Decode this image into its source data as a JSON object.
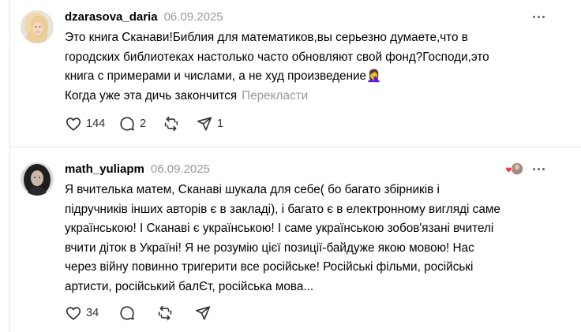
{
  "posts": [
    {
      "username": "dzarasova_daria",
      "date": "06.09.2025",
      "lines": [
        "Это книга Сканави!Библия для математиков,вы серьезно думаете,что в",
        "городских библиотеках настолько часто обновляют свой фонд?Господи,это",
        "книга с примерами и числами, а не худ произведение🤦‍♀️",
        "Когда уже эта дичь закончится"
      ],
      "translate_label": "Перекласти",
      "likes": "144",
      "comments": "2",
      "reposts": "",
      "shares": "1",
      "icons": [
        "heart-icon",
        "comment-icon",
        "repost-icon",
        "send-icon",
        "more-icon"
      ]
    },
    {
      "username": "math_yuliapm",
      "date": "06.09.2025",
      "lines": [
        "Я вчителька матем, Сканаві шукала для себе( бо багато збірників і",
        "підручників інших авторів є в закладі), і багато є в електронному вигляді саме",
        "українською! І Сканаві є українською! І саме українською зобов'язані вчителі",
        "вчити діток в Україні! Я не розумію цієї позиції-байдуже якою мовою! Нас",
        "через війну повинно тригерити все російське! Російські фільми, російські",
        "артисти, російський балЄт, російська мова..."
      ],
      "likes": "34",
      "icons": [
        "heart-icon",
        "comment-icon",
        "repost-icon",
        "send-icon",
        "more-icon",
        "liked-by-author-icon"
      ]
    }
  ],
  "colors": {
    "text": "#000000",
    "muted": "#999999",
    "divider": "#e5e5e5",
    "icon": "#333333",
    "heart_reaction": "#ff3040"
  }
}
